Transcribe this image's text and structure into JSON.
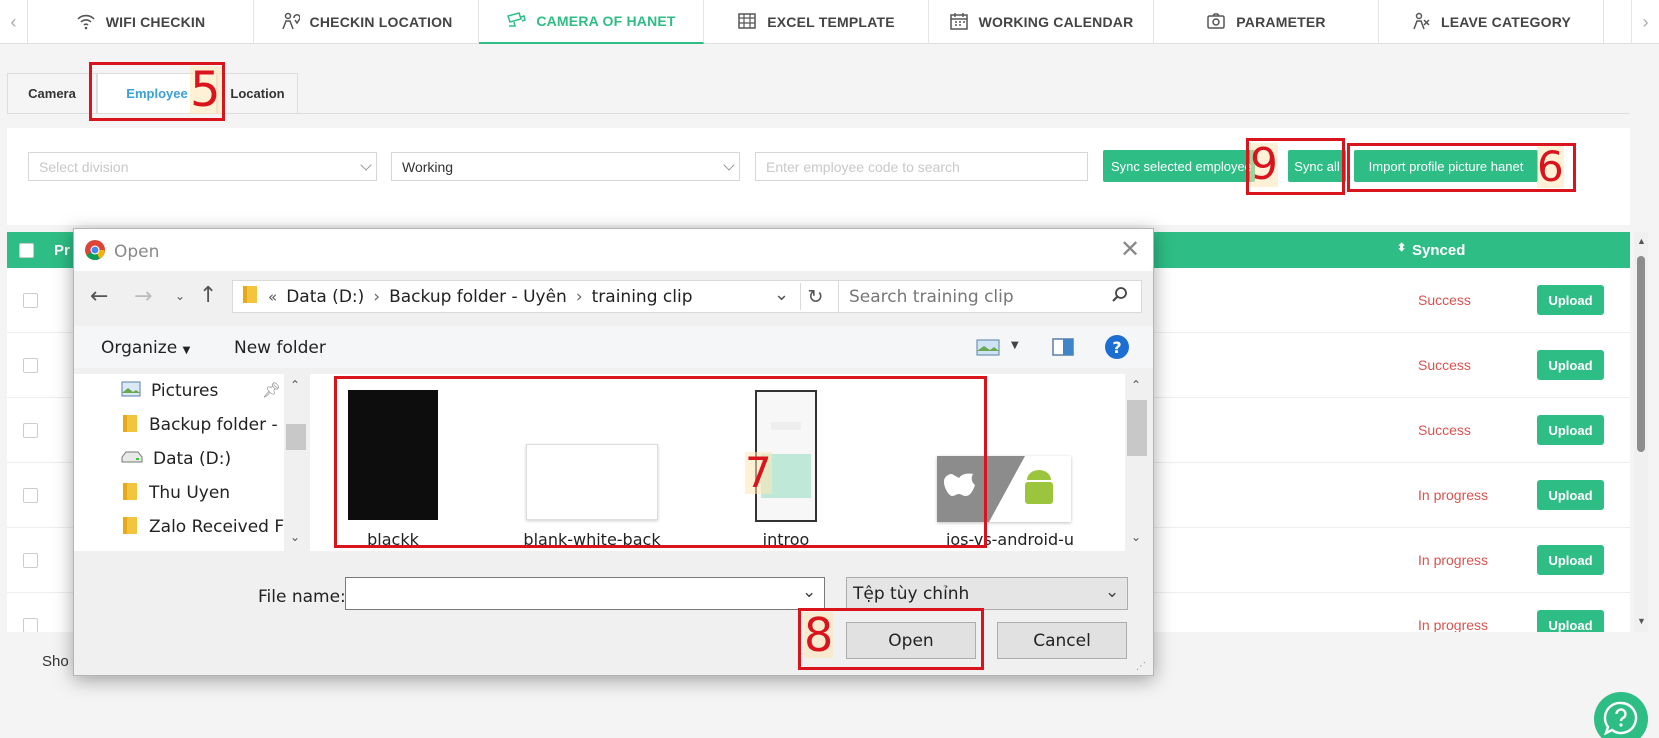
{
  "top_tabs": [
    {
      "label": "WIFI CHECKIN",
      "icon": "wifi-icon"
    },
    {
      "label": "CHECKIN LOCATION",
      "icon": "location-person-icon"
    },
    {
      "label": "CAMERA OF HANET",
      "icon": "camera-cctv-icon",
      "active": true
    },
    {
      "label": "EXCEL TEMPLATE",
      "icon": "table-icon"
    },
    {
      "label": "WORKING CALENDAR",
      "icon": "calendar-icon"
    },
    {
      "label": "PARAMETER",
      "icon": "camera-icon"
    },
    {
      "label": "LEAVE CATEGORY",
      "icon": "leave-person-icon"
    }
  ],
  "sub_tabs": [
    "Camera",
    "Employee",
    "Location"
  ],
  "filters": {
    "division_placeholder": "Select division",
    "status_value": "Working",
    "search_placeholder": "Enter employee code to search"
  },
  "actions": {
    "sync_selected": "Sync selected employee",
    "sync_all": "Sync all",
    "import_profile": "Import profile picture hanet"
  },
  "table": {
    "col_first": "Pr",
    "col_synced": "Synced",
    "rows": [
      {
        "status": "Success",
        "action": "Upload"
      },
      {
        "status": "Success",
        "action": "Upload"
      },
      {
        "status": "Success",
        "action": "Upload"
      },
      {
        "status": "In progress",
        "action": "Upload"
      },
      {
        "status": "In progress",
        "action": "Upload"
      },
      {
        "status": "In progress",
        "action": "Upload"
      }
    ]
  },
  "footer": {
    "show_label": "Sho"
  },
  "dialog": {
    "title": "Open",
    "breadcrumb": [
      "Data (D:)",
      "Backup folder - Uyên",
      "training clip"
    ],
    "search_placeholder": "Search training clip",
    "organize": "Organize",
    "new_folder": "New folder",
    "nav_items": [
      "Pictures",
      "Backup folder - U",
      "Data (D:)",
      "Thu Uyen",
      "Zalo Received Fil"
    ],
    "files": [
      "blackk",
      "blank-white-back",
      "introo",
      "ios-vs-android-u"
    ],
    "file_name_label": "File name:",
    "file_name_value": "",
    "file_type": "Tệp tùy chỉnh",
    "open_button": "Open",
    "cancel_button": "Cancel"
  },
  "annotations": [
    "5",
    "6",
    "7",
    "8",
    "9"
  ],
  "colors": {
    "accent": "#2ebd85",
    "annotation_red": "#d9141c",
    "status_red": "#d9534f",
    "active_subtab": "#3aa0d8"
  }
}
